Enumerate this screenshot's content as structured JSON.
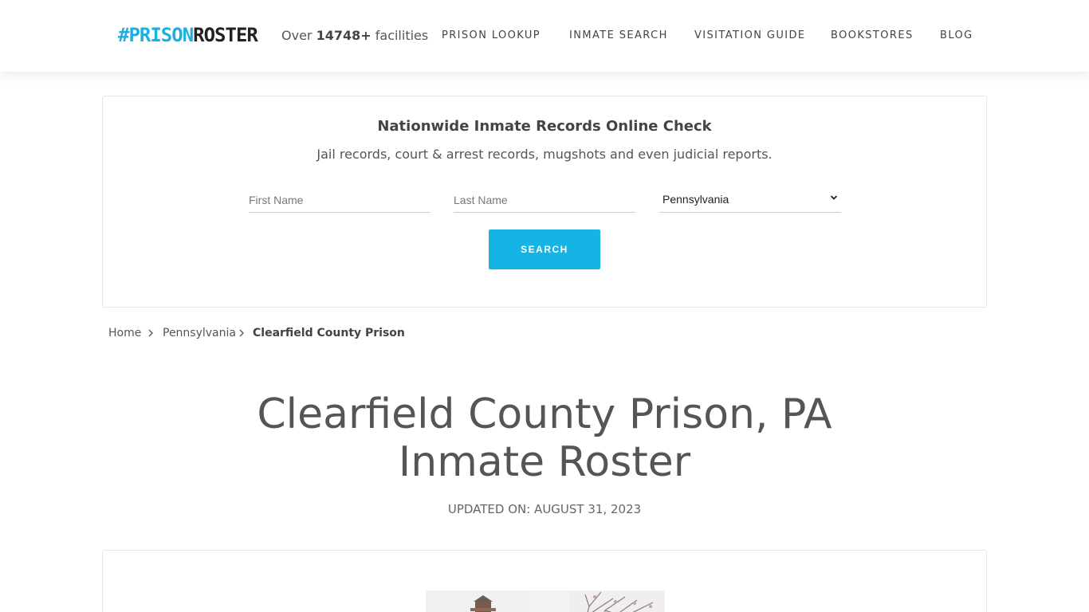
{
  "header": {
    "logo": {
      "hash": "#",
      "prison": "PRISON",
      "roster": "ROSTER"
    },
    "facilities_prefix": "Over",
    "facilities_count": "14748+",
    "facilities_suffix": "facilities",
    "nav": [
      {
        "label": "PRISON LOOKUP"
      },
      {
        "label": "INMATE SEARCH"
      },
      {
        "label": "VISITATION GUIDE"
      },
      {
        "label": "BOOKSTORES"
      },
      {
        "label": "BLOG"
      }
    ]
  },
  "search": {
    "title": "Nationwide Inmate Records Online Check",
    "subtitle": "Jail records, court & arrest records, mugshots and even judicial reports.",
    "first_name_placeholder": "First Name",
    "last_name_placeholder": "Last Name",
    "state_selected": "Pennsylvania",
    "button_label": "SEARCH"
  },
  "breadcrumb": {
    "home": "Home",
    "state": "Pennsylvania",
    "current": "Clearfield County Prison"
  },
  "page": {
    "title_line1": "Clearfield County Prison, PA",
    "title_line2": "Inmate Roster",
    "updated": "UPDATED ON: AUGUST 31, 2023"
  },
  "colors": {
    "accent": "#14b4e5",
    "text": "#555555"
  }
}
